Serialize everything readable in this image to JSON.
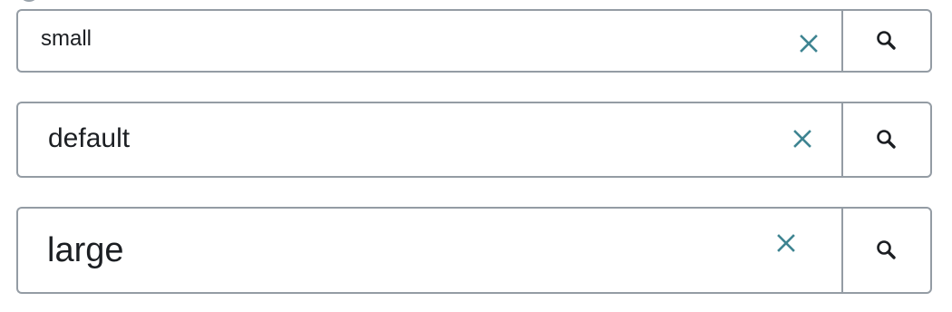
{
  "colors": {
    "border": "#949ca4",
    "clear_icon": "#3e8491",
    "text": "#1b1e22",
    "background": "#ffffff"
  },
  "searches": [
    {
      "size": "small",
      "value": "small",
      "clear_icon": "close-icon",
      "search_icon": "search-icon"
    },
    {
      "size": "default",
      "value": "default",
      "clear_icon": "close-icon",
      "search_icon": "search-icon"
    },
    {
      "size": "large",
      "value": "large",
      "clear_icon": "close-icon",
      "search_icon": "search-icon"
    }
  ]
}
